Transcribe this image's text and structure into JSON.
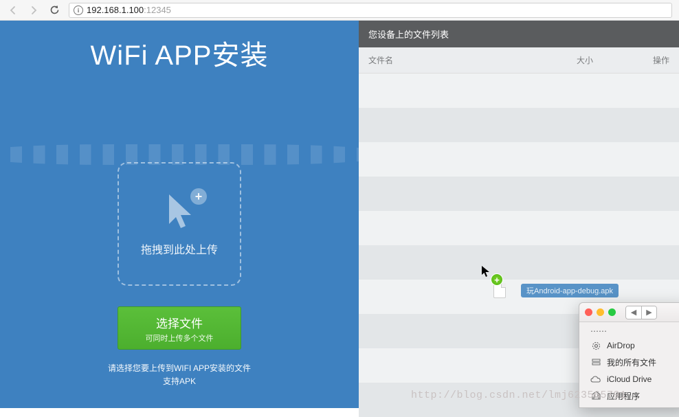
{
  "browser": {
    "url_host": "192.168.1.100",
    "url_port": ":12345"
  },
  "left": {
    "title": "WiFi APP安装",
    "drop_text": "拖拽到此处上传",
    "select_label": "选择文件",
    "select_sub": "可同时上传多个文件",
    "hint_line1": "请选择您要上传到WIFI APP安装的文件",
    "hint_line2": "支持APK"
  },
  "right": {
    "header": "您设备上的文件列表",
    "col_name": "文件名",
    "col_size": "大小",
    "col_op": "操作"
  },
  "drag": {
    "filename": "玩Android-app-debug.apk"
  },
  "finder": {
    "trunc": "...",
    "items": [
      {
        "icon": "airdrop",
        "label": "AirDrop"
      },
      {
        "icon": "allfiles",
        "label": "我的所有文件"
      },
      {
        "icon": "icloud",
        "label": "iCloud Drive"
      },
      {
        "icon": "apps",
        "label": "应用程序"
      }
    ]
  },
  "watermark": "http://blog.csdn.net/lmj623565791"
}
